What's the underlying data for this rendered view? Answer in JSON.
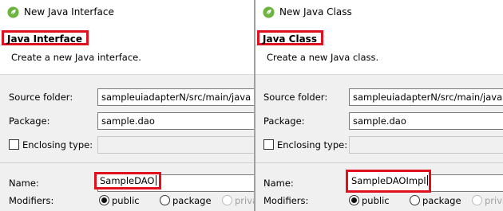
{
  "left_dialog": {
    "window_title": "New Java Interface",
    "app_icon": "spring-leaf-icon",
    "heading": "Java Interface",
    "description": "Create a new Java interface.",
    "source_folder": {
      "label": "Source folder:",
      "value": "sampleuiadapterN/src/main/java"
    },
    "package": {
      "label": "Package:",
      "value": "sample.dao"
    },
    "enclosing_type": {
      "label": "Enclosing type:",
      "checked": false,
      "value": ""
    },
    "name": {
      "label": "Name:",
      "value": "SampleDAO"
    },
    "modifiers": {
      "label": "Modifiers:",
      "options": [
        {
          "label": "public",
          "selected": true,
          "enabled": true
        },
        {
          "label": "package",
          "selected": false,
          "enabled": true
        },
        {
          "label": "priva",
          "selected": false,
          "enabled": false
        }
      ]
    }
  },
  "right_dialog": {
    "window_title": "New Java Class",
    "app_icon": "spring-leaf-icon",
    "heading": "Java Class",
    "description": "Create a new Java class.",
    "source_folder": {
      "label": "Source folder:",
      "value": "sampleuiadapterN/src/main/java"
    },
    "package": {
      "label": "Package:",
      "value": "sample.dao"
    },
    "enclosing_type": {
      "label": "Enclosing type:",
      "checked": false,
      "value": ""
    },
    "name": {
      "label": "Name:",
      "value": "SampleDAOImpl"
    },
    "modifiers": {
      "label": "Modifiers:",
      "options": [
        {
          "label": "public",
          "selected": true,
          "enabled": true
        },
        {
          "label": "package",
          "selected": false,
          "enabled": true
        },
        {
          "label": "priva",
          "selected": false,
          "enabled": false
        }
      ]
    }
  },
  "colors": {
    "highlight_border": "#e0101e",
    "spring_green": "#6db33f",
    "dialog_background": "#f0f0f0"
  }
}
